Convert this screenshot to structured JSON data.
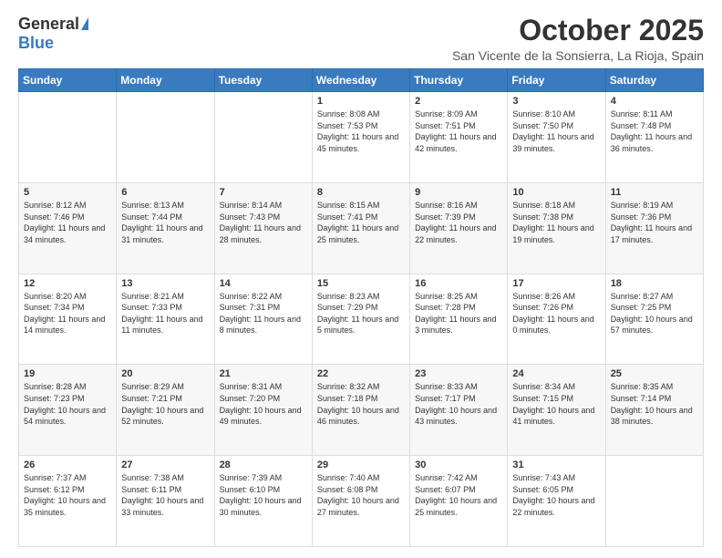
{
  "logo": {
    "general": "General",
    "blue": "Blue"
  },
  "title": "October 2025",
  "location": "San Vicente de la Sonsierra, La Rioja, Spain",
  "days_of_week": [
    "Sunday",
    "Monday",
    "Tuesday",
    "Wednesday",
    "Thursday",
    "Friday",
    "Saturday"
  ],
  "weeks": [
    [
      {
        "day": "",
        "info": ""
      },
      {
        "day": "",
        "info": ""
      },
      {
        "day": "",
        "info": ""
      },
      {
        "day": "1",
        "info": "Sunrise: 8:08 AM\nSunset: 7:53 PM\nDaylight: 11 hours and 45 minutes."
      },
      {
        "day": "2",
        "info": "Sunrise: 8:09 AM\nSunset: 7:51 PM\nDaylight: 11 hours and 42 minutes."
      },
      {
        "day": "3",
        "info": "Sunrise: 8:10 AM\nSunset: 7:50 PM\nDaylight: 11 hours and 39 minutes."
      },
      {
        "day": "4",
        "info": "Sunrise: 8:11 AM\nSunset: 7:48 PM\nDaylight: 11 hours and 36 minutes."
      }
    ],
    [
      {
        "day": "5",
        "info": "Sunrise: 8:12 AM\nSunset: 7:46 PM\nDaylight: 11 hours and 34 minutes."
      },
      {
        "day": "6",
        "info": "Sunrise: 8:13 AM\nSunset: 7:44 PM\nDaylight: 11 hours and 31 minutes."
      },
      {
        "day": "7",
        "info": "Sunrise: 8:14 AM\nSunset: 7:43 PM\nDaylight: 11 hours and 28 minutes."
      },
      {
        "day": "8",
        "info": "Sunrise: 8:15 AM\nSunset: 7:41 PM\nDaylight: 11 hours and 25 minutes."
      },
      {
        "day": "9",
        "info": "Sunrise: 8:16 AM\nSunset: 7:39 PM\nDaylight: 11 hours and 22 minutes."
      },
      {
        "day": "10",
        "info": "Sunrise: 8:18 AM\nSunset: 7:38 PM\nDaylight: 11 hours and 19 minutes."
      },
      {
        "day": "11",
        "info": "Sunrise: 8:19 AM\nSunset: 7:36 PM\nDaylight: 11 hours and 17 minutes."
      }
    ],
    [
      {
        "day": "12",
        "info": "Sunrise: 8:20 AM\nSunset: 7:34 PM\nDaylight: 11 hours and 14 minutes."
      },
      {
        "day": "13",
        "info": "Sunrise: 8:21 AM\nSunset: 7:33 PM\nDaylight: 11 hours and 11 minutes."
      },
      {
        "day": "14",
        "info": "Sunrise: 8:22 AM\nSunset: 7:31 PM\nDaylight: 11 hours and 8 minutes."
      },
      {
        "day": "15",
        "info": "Sunrise: 8:23 AM\nSunset: 7:29 PM\nDaylight: 11 hours and 5 minutes."
      },
      {
        "day": "16",
        "info": "Sunrise: 8:25 AM\nSunset: 7:28 PM\nDaylight: 11 hours and 3 minutes."
      },
      {
        "day": "17",
        "info": "Sunrise: 8:26 AM\nSunset: 7:26 PM\nDaylight: 11 hours and 0 minutes."
      },
      {
        "day": "18",
        "info": "Sunrise: 8:27 AM\nSunset: 7:25 PM\nDaylight: 10 hours and 57 minutes."
      }
    ],
    [
      {
        "day": "19",
        "info": "Sunrise: 8:28 AM\nSunset: 7:23 PM\nDaylight: 10 hours and 54 minutes."
      },
      {
        "day": "20",
        "info": "Sunrise: 8:29 AM\nSunset: 7:21 PM\nDaylight: 10 hours and 52 minutes."
      },
      {
        "day": "21",
        "info": "Sunrise: 8:31 AM\nSunset: 7:20 PM\nDaylight: 10 hours and 49 minutes."
      },
      {
        "day": "22",
        "info": "Sunrise: 8:32 AM\nSunset: 7:18 PM\nDaylight: 10 hours and 46 minutes."
      },
      {
        "day": "23",
        "info": "Sunrise: 8:33 AM\nSunset: 7:17 PM\nDaylight: 10 hours and 43 minutes."
      },
      {
        "day": "24",
        "info": "Sunrise: 8:34 AM\nSunset: 7:15 PM\nDaylight: 10 hours and 41 minutes."
      },
      {
        "day": "25",
        "info": "Sunrise: 8:35 AM\nSunset: 7:14 PM\nDaylight: 10 hours and 38 minutes."
      }
    ],
    [
      {
        "day": "26",
        "info": "Sunrise: 7:37 AM\nSunset: 6:12 PM\nDaylight: 10 hours and 35 minutes."
      },
      {
        "day": "27",
        "info": "Sunrise: 7:38 AM\nSunset: 6:11 PM\nDaylight: 10 hours and 33 minutes."
      },
      {
        "day": "28",
        "info": "Sunrise: 7:39 AM\nSunset: 6:10 PM\nDaylight: 10 hours and 30 minutes."
      },
      {
        "day": "29",
        "info": "Sunrise: 7:40 AM\nSunset: 6:08 PM\nDaylight: 10 hours and 27 minutes."
      },
      {
        "day": "30",
        "info": "Sunrise: 7:42 AM\nSunset: 6:07 PM\nDaylight: 10 hours and 25 minutes."
      },
      {
        "day": "31",
        "info": "Sunrise: 7:43 AM\nSunset: 6:05 PM\nDaylight: 10 hours and 22 minutes."
      },
      {
        "day": "",
        "info": ""
      }
    ]
  ]
}
